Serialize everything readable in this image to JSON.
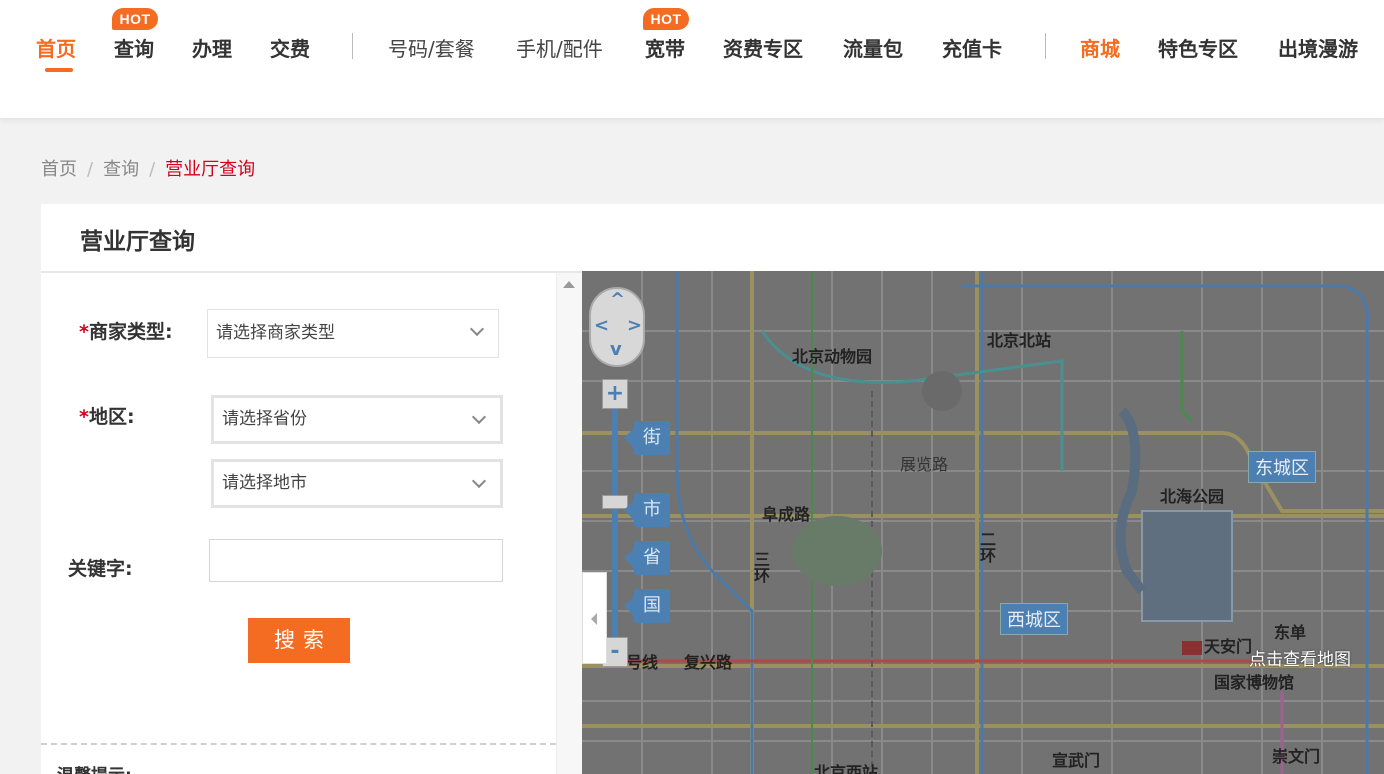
{
  "nav": {
    "items": [
      {
        "label": "首页"
      },
      {
        "label": "查询"
      },
      {
        "label": "办理"
      },
      {
        "label": "交费"
      },
      {
        "label": "号码/套餐"
      },
      {
        "label": "手机/配件"
      },
      {
        "label": "宽带"
      },
      {
        "label": "资费专区"
      },
      {
        "label": "流量包"
      },
      {
        "label": "充值卡"
      },
      {
        "label": "商城"
      },
      {
        "label": "特色专区"
      },
      {
        "label": "出境漫游"
      }
    ],
    "hot_badge": "HOT"
  },
  "breadcrumb": {
    "items": [
      "首页",
      "查询"
    ],
    "separator": "/",
    "current": "营业厅查询"
  },
  "panel": {
    "title": "营业厅查询"
  },
  "form": {
    "required_mark": "*",
    "merchant_type_label": "商家类型:",
    "merchant_type_value": "请选择商家类型",
    "region_label": "地区:",
    "province_value": "请选择省份",
    "city_value": "请选择地市",
    "keyword_label": "关键字:",
    "keyword_value": "",
    "search_label": "搜索",
    "tip_title": "温馨提示:"
  },
  "map": {
    "view_map_text": "点击查看地图",
    "pan_symbols": {
      "up": "^",
      "left": "<",
      "right": ">",
      "down": "v"
    },
    "zoom_in": "+",
    "zoom_out": "-",
    "zoom_tags": [
      "街",
      "市",
      "省",
      "国"
    ],
    "labels": [
      "北京动物园",
      "北京北站",
      "展览路",
      "北海公园",
      "阜成路",
      "三环",
      "二环",
      "天安门",
      "东单",
      "国家博物馆",
      "复兴路",
      "宣武门",
      "崇文门",
      "北京西站",
      "号线"
    ],
    "districts": [
      "东城区",
      "西城区"
    ]
  },
  "colors": {
    "accent": "#f46c21",
    "breadcrumb_current": "#d0021b",
    "map_bg": "#6f6f6f"
  }
}
